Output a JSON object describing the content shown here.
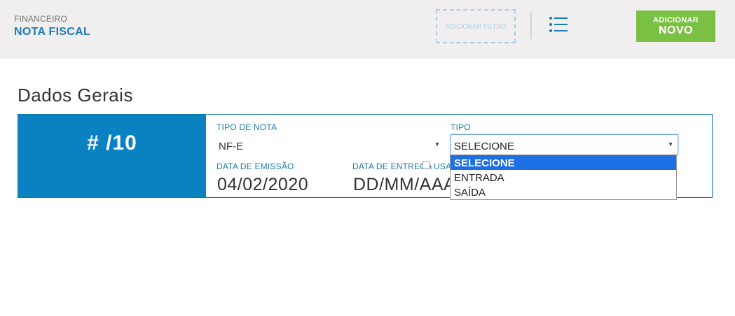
{
  "header": {
    "section": "FINANCEIRO",
    "title": "NOTA FISCAL",
    "filter_button": "ADICIONAR FILTRO",
    "add_button_line1": "ADICIONAR",
    "add_button_line2": "NOVO"
  },
  "main": {
    "section_title": "Dados Gerais",
    "number_display": "# /10",
    "tipo_nota": {
      "label": "TIPO DE NOTA",
      "value": "NF-E"
    },
    "tipo": {
      "label": "TIPO",
      "value": "SELECIONE",
      "options": [
        "SELECIONE",
        "ENTRADA",
        "SAÍDA"
      ],
      "selected_index": 0
    },
    "data_emissao": {
      "label": "DATA DE EMISSÃO",
      "value": "04/02/2020"
    },
    "data_entrega": {
      "label": "DATA DE ENTREGA",
      "value": "DD/MM/AAAA"
    },
    "checkbox_label": "USAR"
  },
  "colors": {
    "brand_blue": "#0a82c2",
    "accent_green": "#7ac143",
    "selected_option": "#1e6ee6"
  },
  "icons": {
    "menu": "list-icon",
    "caret": "caret-down-icon"
  }
}
